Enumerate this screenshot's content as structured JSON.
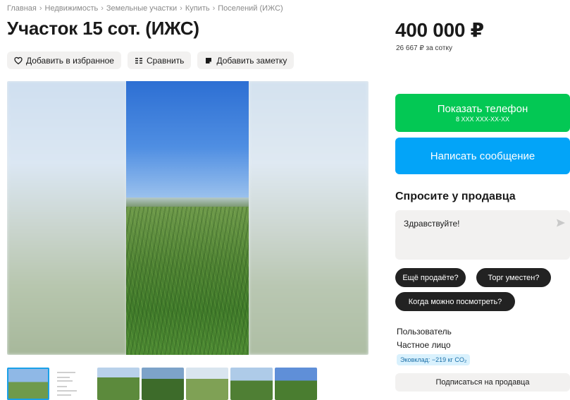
{
  "breadcrumb": [
    "Главная",
    "Недвижимость",
    "Земельные участки",
    "Купить",
    "Поселений (ИЖС)"
  ],
  "breadcrumb_separator": "›",
  "title": "Участок 15 сот. (ИЖС)",
  "actions": {
    "favorite_label": "Добавить в избранное",
    "favorite_icon": "heart-icon",
    "compare_label": "Сравнить",
    "compare_icon": "compare-icon",
    "note_label": "Добавить заметку",
    "note_icon": "note-icon"
  },
  "gallery": {
    "thumbnail_count": 7,
    "active_thumbnail": 1
  },
  "price": {
    "value": "400 000 ₽",
    "per_unit": "26 667 ₽ за сотку"
  },
  "contact": {
    "phone_label": "Показать телефон",
    "phone_masked": "8 XXX XXX-XX-XX",
    "message_label": "Написать сообщение"
  },
  "ask_seller": {
    "title": "Спросите у продавца",
    "input_value": "Здравствуйте!",
    "send_icon": "send-icon",
    "chips": [
      "Ещё продаёте?",
      "Торг уместен?",
      "Когда можно посмотреть?"
    ]
  },
  "seller": {
    "name": "Пользователь",
    "type": "Частное лицо",
    "eco_badge": "Эковклад: −219 кг CO₂",
    "subscribe_label": "Подписаться на продавца"
  },
  "colors": {
    "phone_button": "#03c854",
    "message_button": "#03a4f8",
    "chip": "#222222",
    "secondary_bg": "#f2f1f0",
    "eco_badge_bg": "#d9f1fd"
  }
}
